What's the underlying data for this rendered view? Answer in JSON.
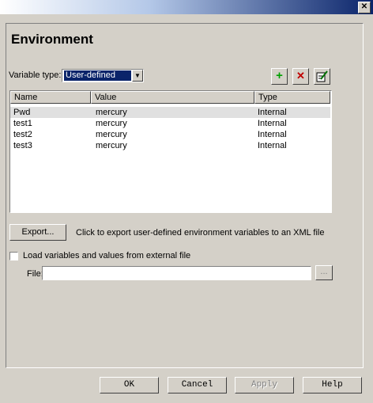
{
  "title_bar": {
    "close_glyph": "✕"
  },
  "page": {
    "title": "Environment"
  },
  "variable_type": {
    "label": "Variable type:",
    "selected": "User-defined"
  },
  "toolbar": {
    "add_icon": "plus-icon",
    "delete_icon": "delete-x-icon",
    "edit_icon": "edit-icon",
    "add_color": "#00a000",
    "delete_color": "#c00000"
  },
  "table": {
    "columns": [
      "Name",
      "Value",
      "Type"
    ],
    "rows": [
      {
        "name": "Pwd",
        "value": "mercury",
        "type": "Internal"
      },
      {
        "name": "test1",
        "value": "mercury",
        "type": "Internal"
      },
      {
        "name": "test2",
        "value": "mercury",
        "type": "Internal"
      },
      {
        "name": "test3",
        "value": "mercury",
        "type": "Internal"
      }
    ]
  },
  "export": {
    "button_label": "Export...",
    "description": "Click to export user-defined environment variables to an XML file"
  },
  "load_external": {
    "label": "Load variables and values from external file",
    "checked": false,
    "file_label": "File:",
    "file_value": "",
    "browse_label": "..."
  },
  "footer": {
    "ok": "OK",
    "cancel": "Cancel",
    "apply": "Apply",
    "help": "Help"
  }
}
